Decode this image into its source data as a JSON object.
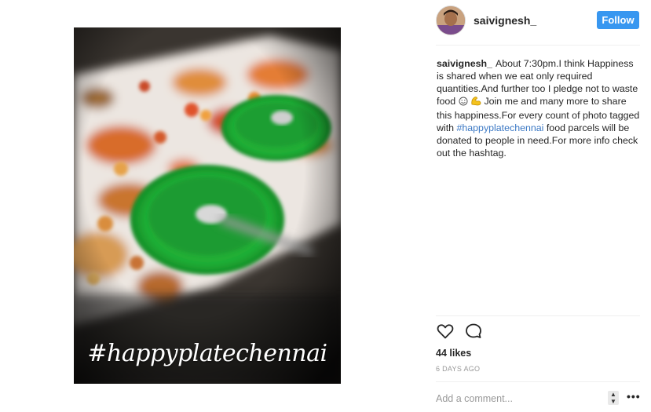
{
  "post": {
    "overlay_text": "#happyplatechennai"
  },
  "header": {
    "username": "saivignesh_",
    "follow_label": "Follow"
  },
  "caption": {
    "username": "saivignesh_",
    "text_before_emoji": "About 7:30pm.I think Happiness is shared when we eat only required quantities.And further too I pledge not to waste food ",
    "emoji_names": [
      "smile-emoji",
      "flexed-biceps-emoji"
    ],
    "text_after_emoji": " Join me and many more to share this happiness.For every count of photo tagged with ",
    "hashtag": "#happyplatechennai",
    "text_end": " food parcels will be donated to people in need.For more info check out the hashtag."
  },
  "actions": {
    "like_icon": "heart-icon",
    "comment_icon": "comment-icon"
  },
  "likes_text": "44 likes",
  "timestamp": "6 DAYS AGO",
  "comment": {
    "placeholder": "Add a comment..."
  },
  "more_label": "•••",
  "colors": {
    "follow_bg": "#3897f0",
    "hashtag": "#3b78c4",
    "plate_green": "#23b33a"
  }
}
